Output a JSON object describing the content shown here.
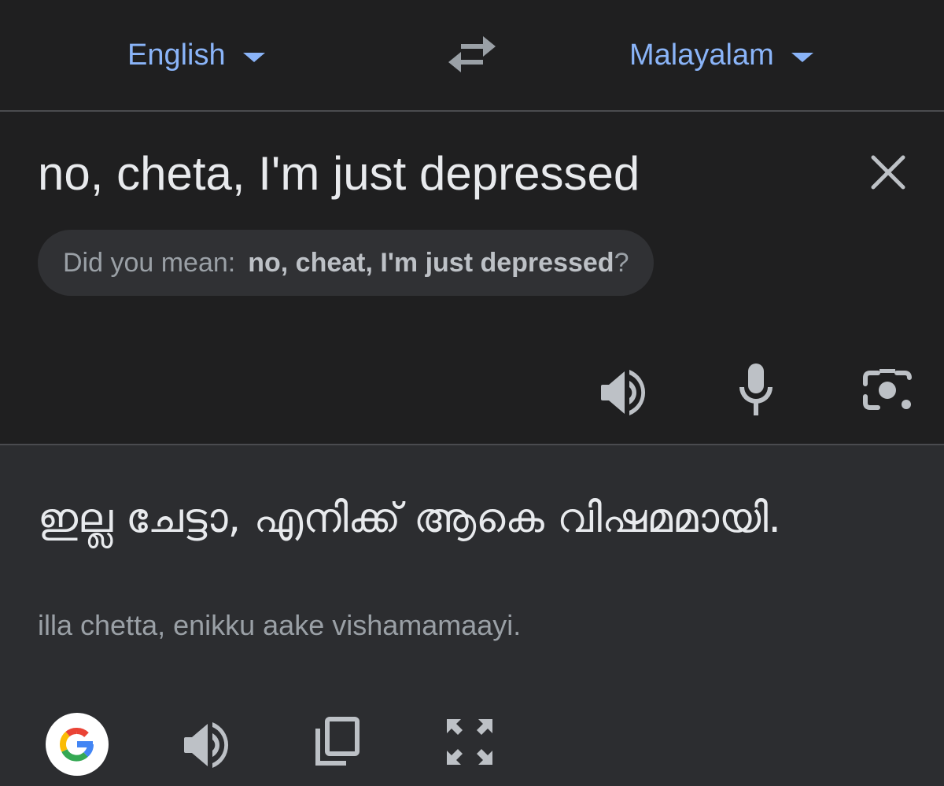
{
  "languages": {
    "source": "English",
    "target": "Malayalam"
  },
  "input": {
    "text": "no, cheta, I'm just depressed",
    "suggestion_prefix": "Did you mean:",
    "suggestion_text": "no, cheat, I'm just depressed",
    "suggestion_suffix": "?"
  },
  "output": {
    "translation": "ഇല്ല ചേട്ടാ, എനിക്ക് ആകെ വിഷമമായി.",
    "transliteration": "illa chetta, enikku aake vishamamaayi."
  },
  "icons": {
    "swap": "swap-arrows-icon",
    "clear": "close-icon",
    "speaker": "speaker-icon",
    "mic": "microphone-icon",
    "camera": "camera-lens-icon",
    "google": "google-logo-icon",
    "copy": "copy-icon",
    "fullscreen": "fullscreen-icon"
  },
  "colors": {
    "accent": "#8ab4f8",
    "background": "#1f1f20",
    "output_background": "#2c2d30",
    "icon": "#bdc1c6"
  }
}
